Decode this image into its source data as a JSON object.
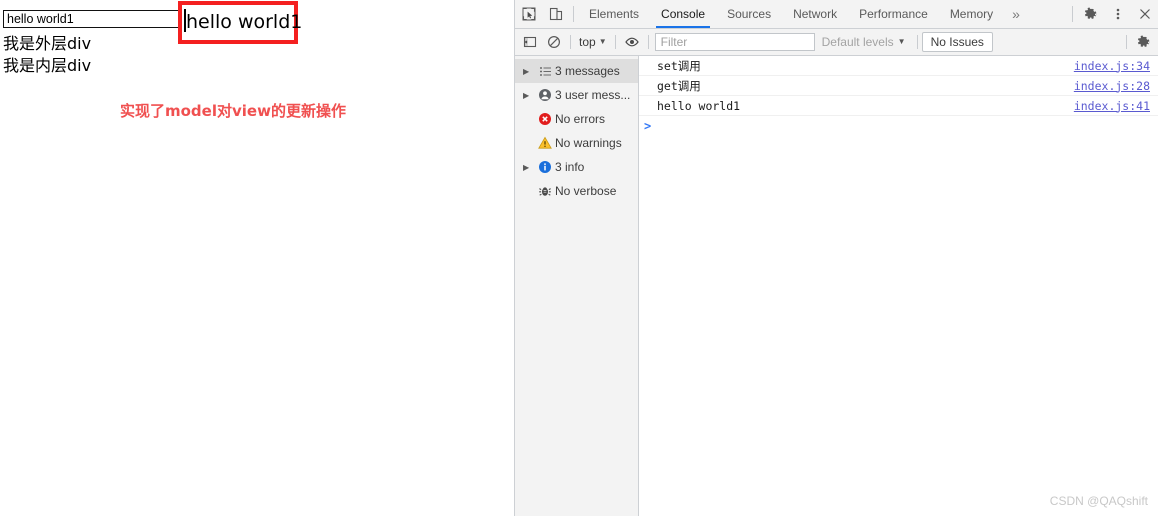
{
  "page": {
    "input_value": "hello world1",
    "input_placeholder": "",
    "outer_div_text": "我是外层div",
    "inner_div_text": "我是内层div",
    "annotation_box_text": "hello world1",
    "annotation_note": "实现了model对view的更新操作",
    "colors": {
      "annotation_border": "#f42020",
      "annotation_note": "#f05050"
    }
  },
  "devtools": {
    "tabs": [
      {
        "label": "Elements",
        "active": false
      },
      {
        "label": "Console",
        "active": true
      },
      {
        "label": "Sources",
        "active": false
      },
      {
        "label": "Network",
        "active": false
      },
      {
        "label": "Performance",
        "active": false
      },
      {
        "label": "Memory",
        "active": false
      }
    ],
    "more_tabs_label": "»",
    "left_icons": [
      {
        "name": "inspect-element-icon"
      },
      {
        "name": "device-toolbar-icon"
      }
    ],
    "right_icons": [
      {
        "name": "settings-gear-icon"
      },
      {
        "name": "more-options-icon"
      },
      {
        "name": "close-devtools-icon"
      }
    ],
    "console_toolbar": {
      "sidebar_toggle_name": "console-sidebar-toggle-icon",
      "clear_console_name": "clear-console-icon",
      "context_selector": "top",
      "eye_icon_name": "live-expression-eye-icon",
      "filter_placeholder": "Filter",
      "filter_value": "",
      "levels_label": "Default levels",
      "issues_label": "No Issues",
      "settings_icon_name": "console-settings-gear-icon"
    },
    "sidebar": [
      {
        "label": "3 messages",
        "icon": "list-icon",
        "expandable": true,
        "selected": true
      },
      {
        "label": "3 user mess...",
        "icon": "user-icon",
        "expandable": true,
        "selected": false
      },
      {
        "label": "No errors",
        "icon": "error-icon",
        "expandable": false,
        "selected": false
      },
      {
        "label": "No warnings",
        "icon": "warning-icon",
        "expandable": false,
        "selected": false
      },
      {
        "label": "3 info",
        "icon": "info-icon",
        "expandable": true,
        "selected": false
      },
      {
        "label": "No verbose",
        "icon": "verbose-icon",
        "expandable": false,
        "selected": false
      }
    ],
    "messages": [
      {
        "text": "set调用",
        "source": "index.js:34"
      },
      {
        "text": "get调用",
        "source": "index.js:28"
      },
      {
        "text": "hello world1",
        "source": "index.js:41"
      }
    ],
    "prompt_caret": ">"
  },
  "watermark": "CSDN @QAQshift"
}
